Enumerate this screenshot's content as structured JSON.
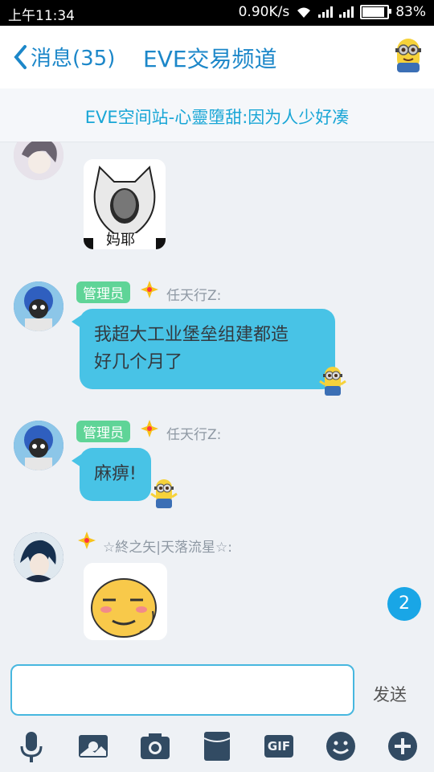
{
  "status_bar": {
    "time": "上午11:34",
    "speed": "0.90K/s",
    "battery": "83%",
    "battery_level": 0.83
  },
  "header": {
    "back_label": "消息(35)",
    "title": "EVE交易频道",
    "accent": "#1c87c9"
  },
  "notice": {
    "text": "EVE空间站-心靈墮甜:因为人少好凑"
  },
  "messages": [
    {
      "role": "管理员",
      "sender": "任天行Z:",
      "text_line1": "我超大工业堡垒组建都造",
      "text_line2": "好几个月了"
    },
    {
      "role": "管理员",
      "sender": "任天行Z:",
      "text_line1": "麻痹!"
    },
    {
      "sender": "☆終之矢|天落流星☆:"
    }
  ],
  "sticker_meme_text": "妈耶",
  "unread_count": "2",
  "input": {
    "value": "",
    "placeholder": "",
    "send_label": "发送"
  },
  "toolbar_icons": [
    "mic-icon",
    "image-icon",
    "camera-icon",
    "red-packet-icon",
    "gif-icon",
    "emoji-icon",
    "plus-icon"
  ],
  "toolbar": {
    "gif_label": "GIF"
  },
  "colors": {
    "bubble": "#48c3e6",
    "badge": "#5fd497",
    "notice_text": "#19a6d6"
  }
}
